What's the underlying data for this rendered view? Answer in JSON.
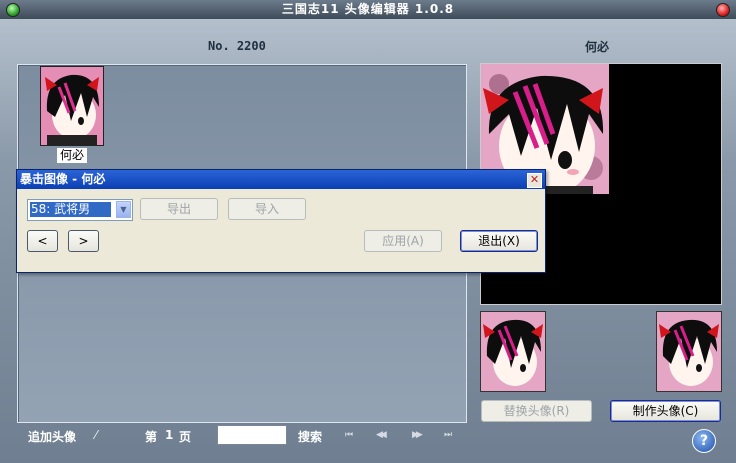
{
  "window": {
    "title": "三国志11 头像编辑器 1.0.8"
  },
  "header": {
    "number_label": "No. 2200",
    "name_label": "何必"
  },
  "list": {
    "items": [
      {
        "name": "何必"
      }
    ]
  },
  "dialog": {
    "title": "暴击图像 - 何必",
    "close_glyph": "✕",
    "select_value": "58: 武将男",
    "export_label": "导出",
    "import_label": "导入",
    "prev_label": "<",
    "next_label": ">",
    "apply_label": "应用(A)",
    "exit_label": "退出(X)"
  },
  "actions": {
    "replace_label": "替换头像(R)",
    "make_label": "制作头像(C)"
  },
  "footer": {
    "add_label": "追加头像",
    "add_glyph": "⁄",
    "page_prefix": "第",
    "page_number": "1",
    "page_suffix": "页",
    "search_label": "搜索",
    "search_value": "",
    "first_glyph": "⏮",
    "prev_glyph": "◀◀",
    "next_glyph": "▶▶",
    "last_glyph": "⏭",
    "help_glyph": "?"
  },
  "colors": {
    "accent": "#316ac5",
    "title_bar": "#0b3fb3",
    "dialog_bg": "#ece9d8"
  }
}
